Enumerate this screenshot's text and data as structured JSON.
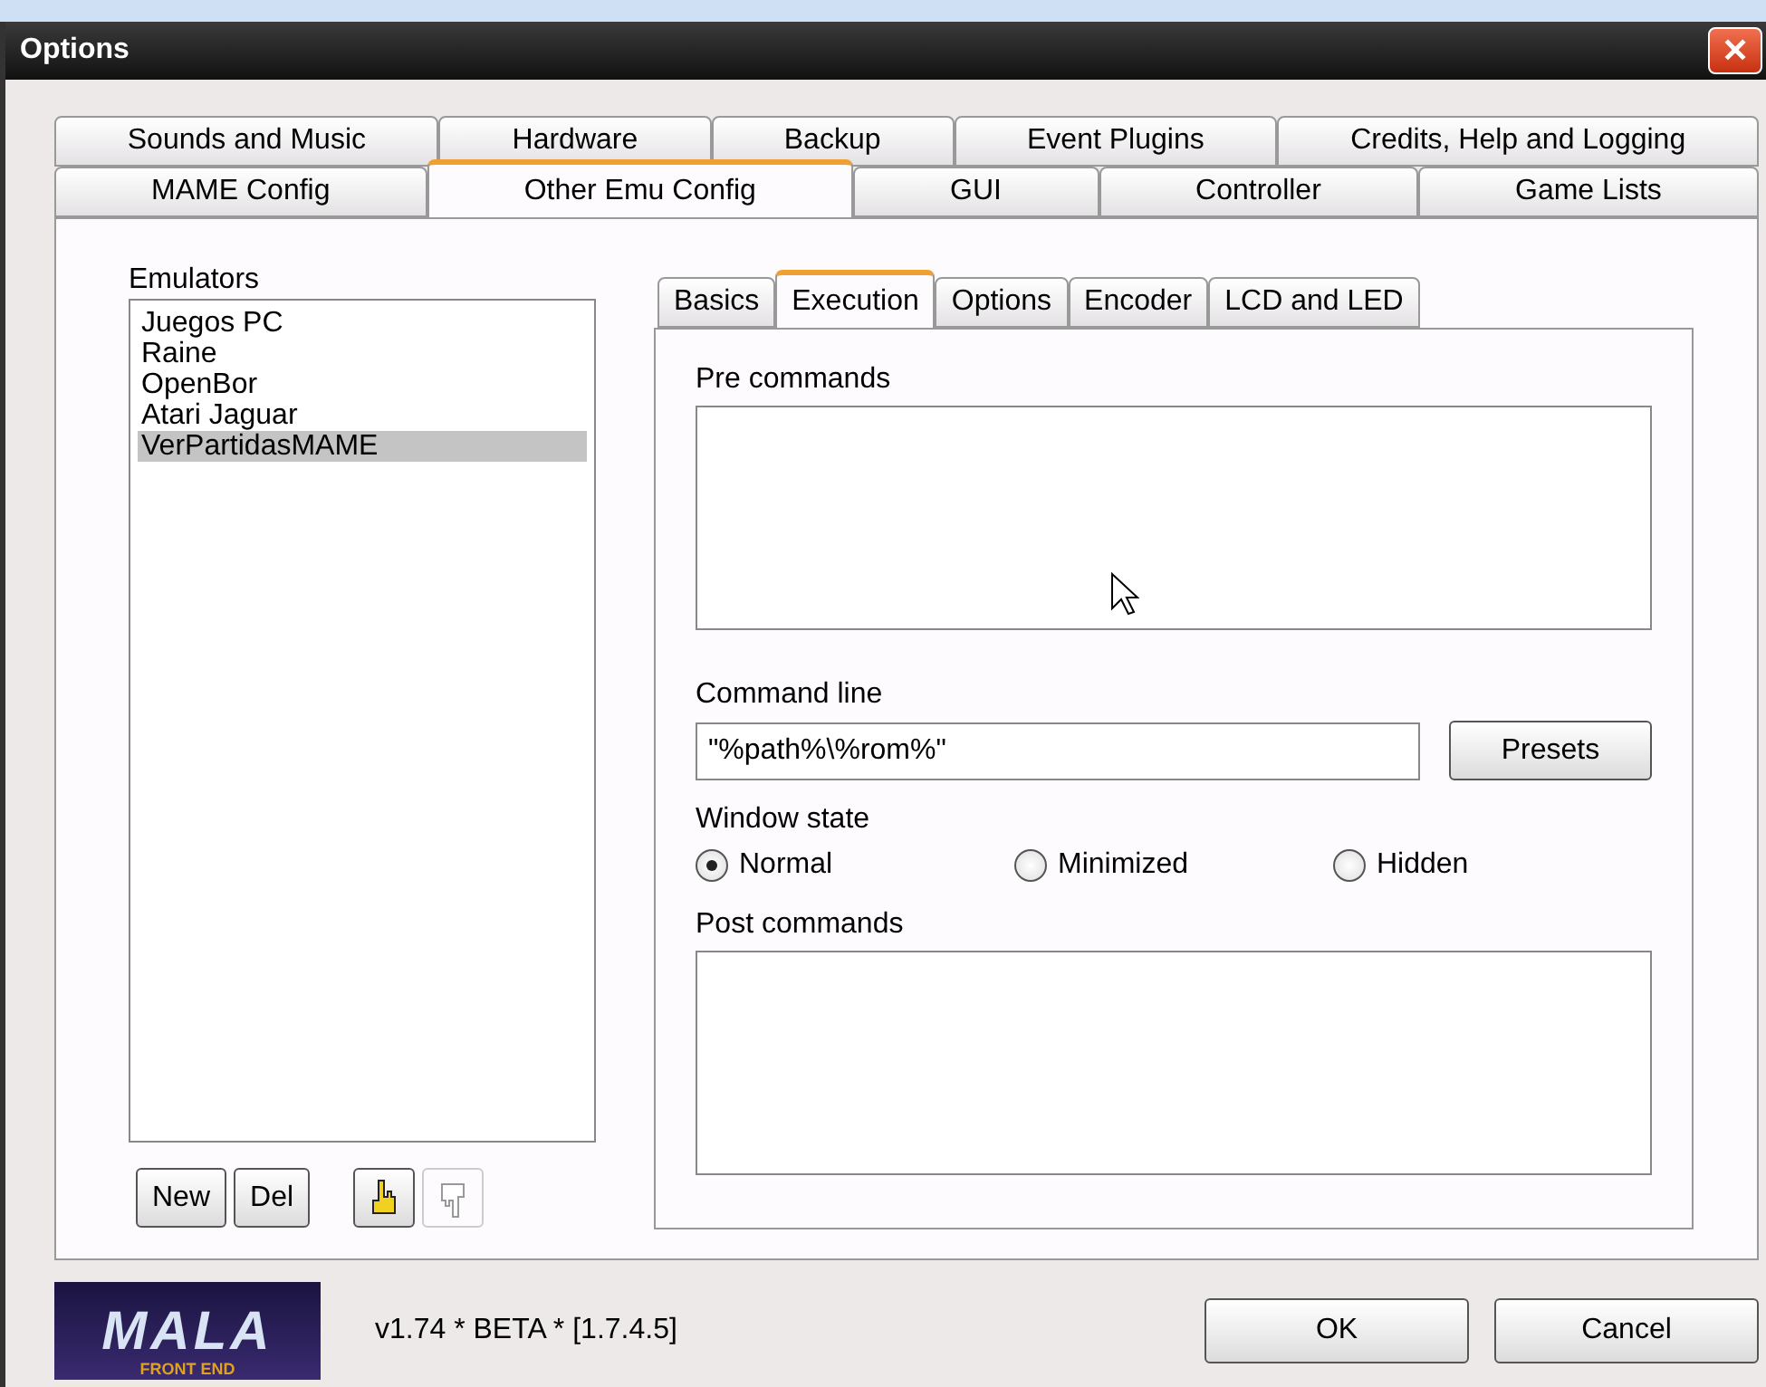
{
  "window": {
    "title": "Options",
    "close": "✕"
  },
  "tab_rows": [
    [
      {
        "label": "Sounds and Music",
        "selected": false
      },
      {
        "label": "Hardware",
        "selected": false
      },
      {
        "label": "Backup",
        "selected": false
      },
      {
        "label": "Event Plugins",
        "selected": false
      },
      {
        "label": "Credits, Help and Logging",
        "selected": false
      }
    ],
    [
      {
        "label": "MAME Config",
        "selected": false
      },
      {
        "label": "Other Emu Config",
        "selected": true
      },
      {
        "label": "GUI",
        "selected": false
      },
      {
        "label": "Controller",
        "selected": false
      },
      {
        "label": "Game Lists",
        "selected": false
      }
    ]
  ],
  "emulators": {
    "label": "Emulators",
    "items": [
      {
        "name": "Juegos PC",
        "selected": false
      },
      {
        "name": "Raine",
        "selected": false
      },
      {
        "name": "OpenBor",
        "selected": false
      },
      {
        "name": "Atari Jaguar",
        "selected": false
      },
      {
        "name": "VerPartidasMAME",
        "selected": true
      }
    ],
    "buttons": [
      "New",
      "Del"
    ],
    "move_up": {
      "disabled": false
    },
    "move_down": {
      "disabled": true
    }
  },
  "sub_tabs": [
    {
      "label": "Basics",
      "selected": false
    },
    {
      "label": "Execution",
      "selected": true
    },
    {
      "label": "Options",
      "selected": false
    },
    {
      "label": "Encoder",
      "selected": false
    },
    {
      "label": "LCD and LED",
      "selected": false
    }
  ],
  "execution": {
    "pre_commands_label": "Pre commands",
    "command_line_label": "Command line",
    "command_line": "\"%path%\\%rom%\"",
    "presets": "Presets",
    "window_state_label": "Window state",
    "window_states": [
      {
        "label": "Normal",
        "selected": true
      },
      {
        "label": "Minimized",
        "selected": false
      },
      {
        "label": "Hidden",
        "selected": false
      }
    ],
    "post_commands_label": "Post commands"
  },
  "footer": {
    "logo_title": "MALA",
    "logo_subtitle": "FRONT END",
    "version": "v1.74  * BETA * [1.7.4.5]",
    "ok": "OK",
    "cancel": "Cancel"
  }
}
